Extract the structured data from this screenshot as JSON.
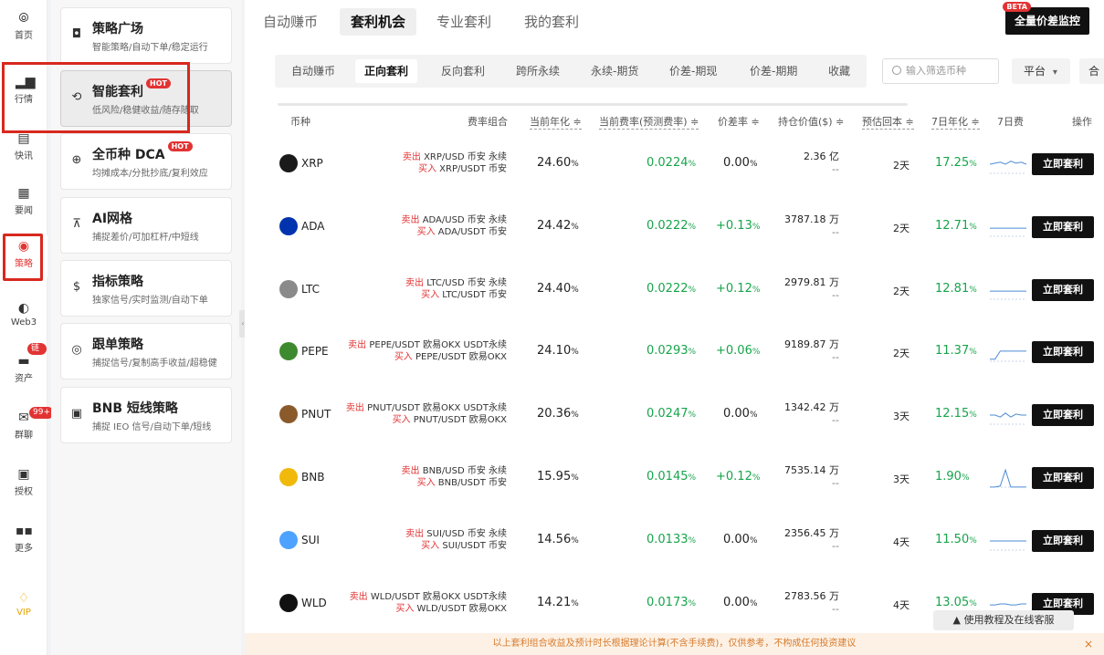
{
  "rail": {
    "items": [
      {
        "icon": "home-icon",
        "glyph": "⦾",
        "label": "首页"
      },
      {
        "icon": "market-icon",
        "glyph": "▂▆",
        "label": "行情"
      },
      {
        "icon": "news-flash-icon",
        "glyph": "▤",
        "label": "快讯"
      },
      {
        "icon": "news-icon",
        "glyph": "▦",
        "label": "要闻"
      },
      {
        "icon": "strategy-icon",
        "glyph": "◉",
        "label": "策略"
      },
      {
        "icon": "web3-icon",
        "glyph": "◐",
        "label": "Web3"
      },
      {
        "icon": "assets-icon",
        "glyph": "▬",
        "label": "资产"
      },
      {
        "icon": "chat-icon",
        "glyph": "✉",
        "label": "群聊"
      },
      {
        "icon": "auth-icon",
        "glyph": "▣",
        "label": "授权"
      },
      {
        "icon": "more-icon",
        "glyph": "▪▪",
        "label": "更多"
      },
      {
        "icon": "vip-icon",
        "glyph": "♢",
        "label": "VIP"
      }
    ],
    "badges": {
      "assets": "链上",
      "chat": "99+"
    }
  },
  "panel": {
    "cards": [
      {
        "icon": "square-bot-icon",
        "glyph": "◘",
        "title": "策略广场",
        "desc": "智能策略/自动下单/稳定运行",
        "hot": ""
      },
      {
        "icon": "arbitrage-icon",
        "glyph": "⟲",
        "title": "智能套利",
        "desc": "低风险/稳健收益/随存随取",
        "hot": "HOT"
      },
      {
        "icon": "dca-icon",
        "glyph": "⊕",
        "title": "全币种 DCA",
        "desc": "均摊成本/分批抄底/复利效应",
        "hot": "HOT"
      },
      {
        "icon": "grid-icon",
        "glyph": "⊼",
        "title": "AI网格",
        "desc": "捕捉差价/可加杠杆/中短线",
        "hot": ""
      },
      {
        "icon": "indicator-icon",
        "glyph": "$",
        "title": "指标策略",
        "desc": "独家信号/实时监测/自动下单",
        "hot": ""
      },
      {
        "icon": "copy-trade-icon",
        "glyph": "◎",
        "title": "跟单策略",
        "desc": "捕捉信号/复制高手收益/超稳健",
        "hot": ""
      },
      {
        "icon": "bnb-short-icon",
        "glyph": "▣",
        "title": "BNB 短线策略",
        "desc": "捕捉 IEO 信号/自动下单/短线",
        "hot": ""
      }
    ]
  },
  "top_tabs": [
    "自动赚币",
    "套利机会",
    "专业套利",
    "我的套利"
  ],
  "monitor": {
    "label": "全量价差监控",
    "beta": "BETA"
  },
  "sub_tabs": [
    "自动赚币",
    "正向套利",
    "反向套利",
    "跨所永续",
    "永续-期货",
    "价差-期现",
    "价差-期期",
    "收藏"
  ],
  "search": {
    "placeholder": "输入筛选币种"
  },
  "platform": {
    "label": "平台",
    "arrow": "▾"
  },
  "merge": {
    "label": "合"
  },
  "columns": {
    "coin": "币种",
    "combo": "费率组合",
    "annual": "当前年化 ≑",
    "rate": "当前费率(预测费率) ≑",
    "spread": "价差率 ≑",
    "hold": "持仓价值($) ≑",
    "payback": "预估回本 ≑",
    "annual7": "7日年化 ≑",
    "fee7": "7日费",
    "action": "操作"
  },
  "rows": [
    {
      "coin": "XRP",
      "color": "#1a1a1a",
      "sell_tag": "卖出",
      "sell": "XRP/USD 币安 永续",
      "buy_tag": "买入",
      "buy": "XRP/USDT 币安",
      "annual": "24.60",
      "rate": "0.0224",
      "spread": "0.00",
      "spread_color": "dark",
      "hold": "2.36 亿",
      "hold2": "--",
      "payback": "2天",
      "annual7": "17.25",
      "action": "立即套利",
      "spark": [
        0.5,
        0.45,
        0.4,
        0.5,
        0.35,
        0.45,
        0.4,
        0.5
      ]
    },
    {
      "coin": "ADA",
      "color": "#0033ad",
      "sell_tag": "卖出",
      "sell": "ADA/USD 币安 永续",
      "buy_tag": "买入",
      "buy": "ADA/USDT 币安",
      "annual": "24.42",
      "rate": "0.0222",
      "spread": "+0.13",
      "spread_color": "green",
      "hold": "3787.18 万",
      "hold2": "--",
      "payback": "2天",
      "annual7": "12.71",
      "action": "立即套利",
      "spark": [
        0.55,
        0.55,
        0.55,
        0.55,
        0.55,
        0.55,
        0.55,
        0.55
      ]
    },
    {
      "coin": "LTC",
      "color": "#8a8a8a",
      "sell_tag": "卖出",
      "sell": "LTC/USD 币安 永续",
      "buy_tag": "买入",
      "buy": "LTC/USDT 币安",
      "annual": "24.40",
      "rate": "0.0222",
      "spread": "+0.12",
      "spread_color": "green",
      "hold": "2979.81 万",
      "hold2": "--",
      "payback": "2天",
      "annual7": "12.81",
      "action": "立即套利",
      "spark": [
        0.55,
        0.55,
        0.55,
        0.55,
        0.55,
        0.55,
        0.55,
        0.55
      ]
    },
    {
      "coin": "PEPE",
      "color": "#3e8a2f",
      "sell_tag": "卖出",
      "sell": "PEPE/USDT 欧易OKX USDT永续",
      "buy_tag": "买入",
      "buy": "PEPE/USDT 欧易OKX",
      "annual": "24.10",
      "rate": "0.0293",
      "spread": "+0.06",
      "spread_color": "green",
      "hold": "9189.87 万",
      "hold2": "--",
      "payback": "2天",
      "annual7": "11.37",
      "action": "立即套利",
      "spark": [
        0.85,
        0.85,
        0.45,
        0.45,
        0.45,
        0.45,
        0.45,
        0.45
      ]
    },
    {
      "coin": "PNUT",
      "color": "#8b5a2b",
      "sell_tag": "卖出",
      "sell": "PNUT/USDT 欧易OKX USDT永续",
      "buy_tag": "买入",
      "buy": "PNUT/USDT 欧易OKX",
      "annual": "20.36",
      "rate": "0.0247",
      "spread": "0.00",
      "spread_color": "dark",
      "hold": "1342.42 万",
      "hold2": "--",
      "payback": "3天",
      "annual7": "12.15",
      "action": "立即套利",
      "spark": [
        0.5,
        0.5,
        0.6,
        0.4,
        0.6,
        0.45,
        0.5,
        0.5
      ]
    },
    {
      "coin": "BNB",
      "color": "#f0b90b",
      "sell_tag": "卖出",
      "sell": "BNB/USD 币安 永续",
      "buy_tag": "买入",
      "buy": "BNB/USDT 币安",
      "annual": "15.95",
      "rate": "0.0145",
      "spread": "+0.12",
      "spread_color": "green",
      "hold": "7535.14 万",
      "hold2": "--",
      "payback": "3天",
      "annual7": "1.90",
      "action": "立即套利",
      "spark": [
        0.95,
        0.95,
        0.9,
        0.1,
        0.95,
        0.95,
        0.95,
        0.95
      ]
    },
    {
      "coin": "SUI",
      "color": "#4da2ff",
      "sell_tag": "卖出",
      "sell": "SUI/USD 币安 永续",
      "buy_tag": "买入",
      "buy": "SUI/USDT 币安",
      "annual": "14.56",
      "rate": "0.0133",
      "spread": "0.00",
      "spread_color": "dark",
      "hold": "2356.45 万",
      "hold2": "--",
      "payback": "4天",
      "annual7": "11.50",
      "action": "立即套利",
      "spark": [
        0.5,
        0.5,
        0.5,
        0.5,
        0.5,
        0.5,
        0.5,
        0.5
      ]
    },
    {
      "coin": "WLD",
      "color": "#111111",
      "sell_tag": "卖出",
      "sell": "WLD/USDT 欧易OKX USDT永续",
      "buy_tag": "买入",
      "buy": "WLD/USDT 欧易OKX",
      "annual": "14.21",
      "rate": "0.0173",
      "spread": "0.00",
      "spread_color": "dark",
      "hold": "2783.56 万",
      "hold2": "--",
      "payback": "4天",
      "annual7": "13.05",
      "action": "立即套利",
      "spark": [
        0.55,
        0.55,
        0.5,
        0.5,
        0.55,
        0.55,
        0.5,
        0.5
      ]
    }
  ],
  "percent_unit": "%",
  "help_tip": "▲ 使用教程及在线客服",
  "bottom_notice": "以上套利组合收益及预计时长根据理论计算(不含手续费)，仅供参考，不构成任何投资建议",
  "bottom_close": "×",
  "collapse": "‹",
  "colors": {
    "accent_red": "#e23333",
    "green": "#17a44b",
    "spark": "#4d8bd6"
  }
}
